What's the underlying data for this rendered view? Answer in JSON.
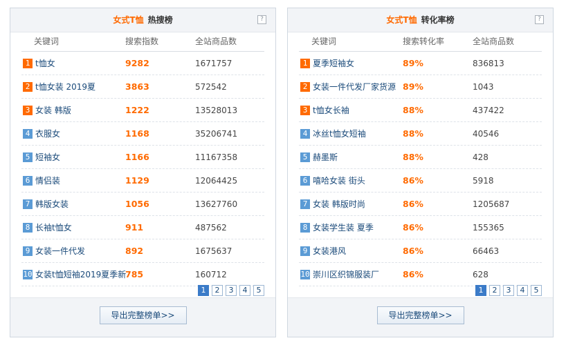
{
  "left_panel": {
    "category": "女式T恤",
    "title": "热搜榜",
    "help": "?",
    "headers": {
      "keyword": "关键词",
      "metric": "搜索指数",
      "count": "全站商品数"
    },
    "rows": [
      {
        "rank": "1",
        "keyword": "t恤女",
        "metric": "9282",
        "count": "1671757"
      },
      {
        "rank": "2",
        "keyword": "t恤女装 2019夏",
        "metric": "3863",
        "count": "572542"
      },
      {
        "rank": "3",
        "keyword": "女装 韩版",
        "metric": "1222",
        "count": "13528013"
      },
      {
        "rank": "4",
        "keyword": "衣服女",
        "metric": "1168",
        "count": "35206741"
      },
      {
        "rank": "5",
        "keyword": "短袖女",
        "metric": "1166",
        "count": "11167358"
      },
      {
        "rank": "6",
        "keyword": "情侣装",
        "metric": "1129",
        "count": "12064425"
      },
      {
        "rank": "7",
        "keyword": "韩版女装",
        "metric": "1056",
        "count": "13627760"
      },
      {
        "rank": "8",
        "keyword": "长袖t恤女",
        "metric": "911",
        "count": "487562"
      },
      {
        "rank": "9",
        "keyword": "女装一件代发",
        "metric": "892",
        "count": "1675637"
      },
      {
        "rank": "10",
        "keyword": "女装t恤短袖2019夏季新",
        "metric": "785",
        "count": "160712"
      }
    ],
    "pages": [
      "1",
      "2",
      "3",
      "4",
      "5"
    ],
    "export_label": "导出完整榜单>>"
  },
  "right_panel": {
    "category": "女式T恤",
    "title": "转化率榜",
    "help": "?",
    "headers": {
      "keyword": "关键词",
      "metric": "搜索转化率",
      "count": "全站商品数"
    },
    "rows": [
      {
        "rank": "1",
        "keyword": "夏季短袖女",
        "metric": "89%",
        "count": "836813"
      },
      {
        "rank": "2",
        "keyword": "女装一件代发厂家货源",
        "metric": "89%",
        "count": "1043"
      },
      {
        "rank": "3",
        "keyword": "t恤女长袖",
        "metric": "88%",
        "count": "437422"
      },
      {
        "rank": "4",
        "keyword": "冰丝t恤女短袖",
        "metric": "88%",
        "count": "40546"
      },
      {
        "rank": "5",
        "keyword": "赫墨斯",
        "metric": "88%",
        "count": "428"
      },
      {
        "rank": "6",
        "keyword": "嘻哈女装 街头",
        "metric": "86%",
        "count": "5918"
      },
      {
        "rank": "7",
        "keyword": "女装 韩版时尚",
        "metric": "86%",
        "count": "1205687"
      },
      {
        "rank": "8",
        "keyword": "女装学生装 夏季",
        "metric": "86%",
        "count": "155365"
      },
      {
        "rank": "9",
        "keyword": "女装港风",
        "metric": "86%",
        "count": "66463"
      },
      {
        "rank": "10",
        "keyword": "崇川区织锦服装厂",
        "metric": "86%",
        "count": "628"
      }
    ],
    "pages": [
      "1",
      "2",
      "3",
      "4",
      "5"
    ],
    "export_label": "导出完整榜单>>"
  },
  "colors": {
    "accent": "#ff6a00",
    "link": "#1a4a7a",
    "rank_top": "#ff6a00",
    "rank_other": "#5b9bd5",
    "page_active": "#3b7bc8"
  },
  "icons": {
    "help": "help-icon"
  }
}
